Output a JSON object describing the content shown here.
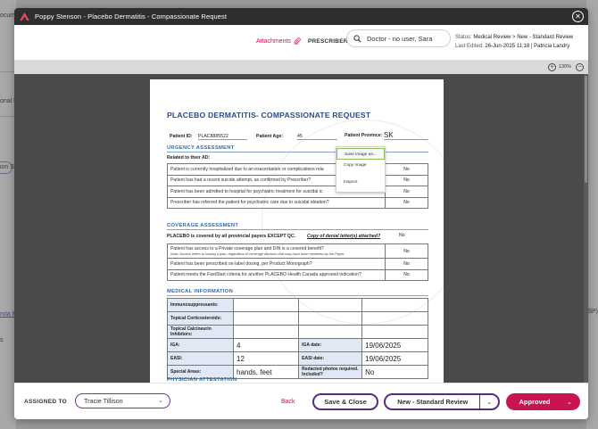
{
  "background": {
    "left_fragments": [
      "ocum",
      "onal F",
      "ion Sig",
      "nda M",
      "s"
    ],
    "right_fragments": [
      "SP)"
    ]
  },
  "modal": {
    "title": "Poppy Stenson - Placebo Dermatitis - Compassionate Request",
    "close_icon": "close-icon"
  },
  "header": {
    "attachments_label": "Attachments",
    "prescriber_label": "PRESCRIBER",
    "prescriber_value": "Doctor - no user, Sara",
    "status_label": "Status:",
    "status_value": "Medical Review > New - Standard Review",
    "last_edited_label": "Last Edited:",
    "last_edited_value": "26-Jun-2025 11:18 | Patricia Landry"
  },
  "toolbar": {
    "zoom_level": "130%"
  },
  "document": {
    "title": "PLACEBO DERMATITIS- COMPASSIONATE REQUEST",
    "patient_id_label": "Patient ID:",
    "patient_id_value": "PLAC8885522",
    "patient_age_label": "Patient Age:",
    "patient_age_value": "45",
    "patient_province_label": "Patient Province:",
    "patient_province_value": "SK",
    "urgency_heading": "URGENCY ASSESSMENT",
    "related_ad_label": "Related to their AD:",
    "urgency_rows": [
      {
        "q": "Patient is currently hospitalized due to an exacerbation or complications rela",
        "a": "No"
      },
      {
        "q": "Patient has had a recent suicide attempt, as confirmed by Prescriber?",
        "a": "No"
      },
      {
        "q": "Patient has been admitted to hospital for psychiatric treatment for suicidal ic",
        "a": "No"
      },
      {
        "q": "Prescriber has referred the patient for psychiatric care due to suicidal ideation?",
        "a": "No"
      }
    ],
    "coverage_heading": "COVERAGE ASSESSMENT",
    "coverage_line": "PLACEBO is covered by all provincial payers EXCEPT QC.",
    "denial_label": "Copy of denial letter(s) attached?",
    "denial_value": "No",
    "coverage_rows": [
      {
        "q": "Patient has access to a Private coverage plan and DIN is a covered benefit?",
        "note": "Note: Access refers to having a plan, regardless of coverage decision that may have been rendered by the Payer.",
        "a": "No"
      },
      {
        "q": "Patient has been prescribed on-label dosing, per Product Monograph?",
        "note": "",
        "a": "No"
      },
      {
        "q": "Patient meets the FastStart criteria for another PLACEBO Health Canada approved indication?",
        "note": "",
        "a": "No"
      }
    ],
    "medical_heading": "MEDICAL INFORMATION",
    "medical": {
      "immuno_label": "Immunosuppressants:",
      "cortico_label": "Topical Corticosteroids:",
      "calcineurin_label": "Topical Calcineurin Inhibitors:",
      "iga_label": "IGA:",
      "iga_value": "4",
      "iga_date_label": "IGA date:",
      "iga_date_value": "19/06/2025",
      "easi_label": "EASI:",
      "easi_value": "12",
      "easi_date_label": "EASI date:",
      "easi_date_value": "19/06/2025",
      "special_label": "Special Areas:",
      "special_value": "hands, feet",
      "redacted_label": "Redacted photos required. Included?",
      "redacted_value": "No"
    },
    "physician_heading": "PHYSICIAN ATTESTATION"
  },
  "context_menu": {
    "items": [
      "Save image as...",
      "Copy image",
      "Inspect"
    ]
  },
  "footer": {
    "assigned_label": "ASSIGNED TO",
    "assignee": "Tracie Tillison",
    "back_label": "Back",
    "save_close_label": "Save & Close",
    "review_label": "New - Standard Review",
    "approved_label": "Approved"
  },
  "colors": {
    "accent_pink": "#c8154f",
    "accent_purple": "#5a2d7a",
    "doc_heading_blue": "#2b6bb0"
  }
}
